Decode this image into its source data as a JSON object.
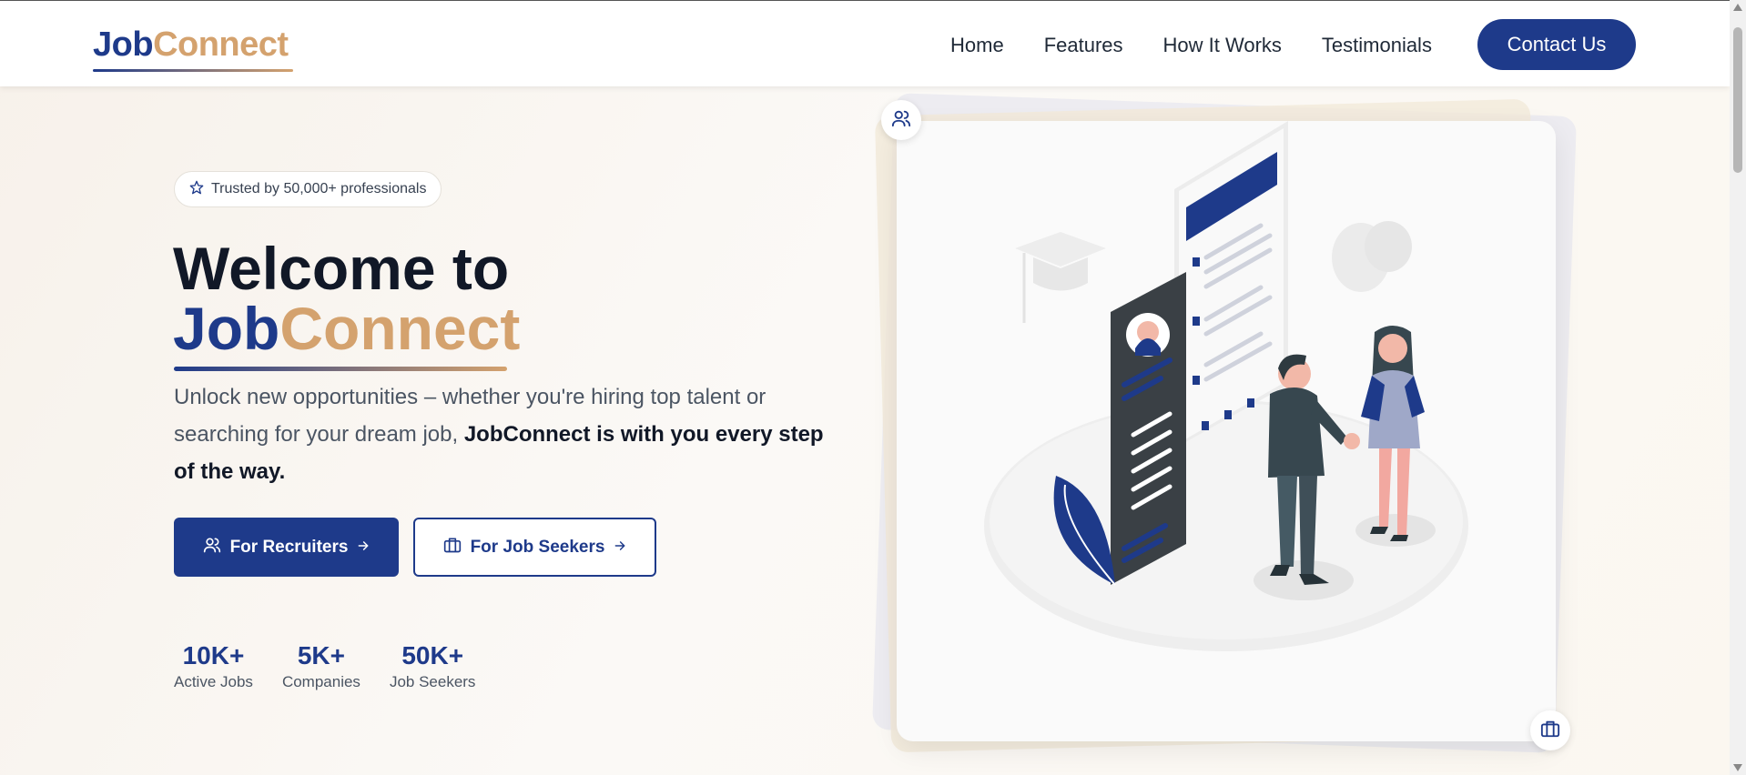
{
  "nav": {
    "logo_job": "Job",
    "logo_connect": "Connect",
    "links": [
      "Home",
      "Features",
      "How It Works",
      "Testimonials"
    ],
    "contact_label": "Contact Us"
  },
  "hero": {
    "badge": "Trusted by 50,000+ professionals",
    "title_line1": "Welcome to",
    "title_job": "Job",
    "title_connect": "Connect",
    "desc_plain": "Unlock new opportunities – whether you're hiring top talent or searching for your dream job,",
    "desc_bold": "JobConnect is with you every step of the way.",
    "btn_recruiters": "For Recruiters",
    "btn_seekers": "For Job Seekers"
  },
  "stats": [
    {
      "value": "10K+",
      "label": "Active Jobs"
    },
    {
      "value": "5K+",
      "label": "Companies"
    },
    {
      "value": "50K+",
      "label": "Job Seekers"
    }
  ],
  "colors": {
    "primary": "#1e3a8a",
    "accent": "#d4a26e"
  },
  "icons": {
    "badge": "star-icon",
    "recruiters": "users-icon",
    "seekers": "briefcase-icon",
    "arrow": "arrow-right-icon"
  }
}
